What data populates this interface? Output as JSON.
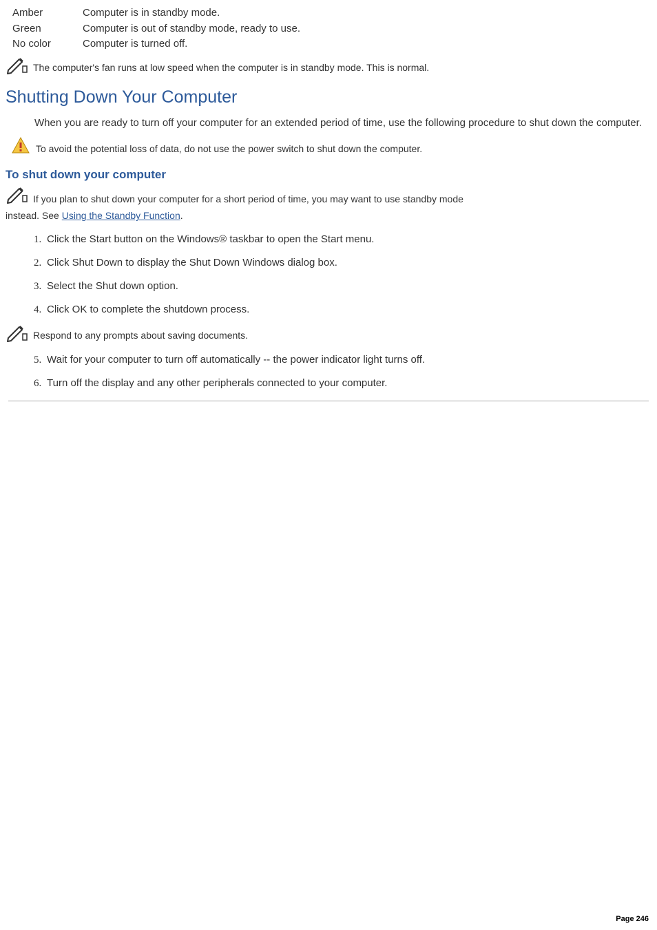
{
  "status": [
    {
      "label": "Amber",
      "desc": "Computer is in standby mode."
    },
    {
      "label": "Green",
      "desc": "Computer is out of standby mode, ready to use."
    },
    {
      "label": "No color",
      "desc": "Computer is turned off."
    }
  ],
  "note_fan": "The computer's fan runs at low speed when the computer is in standby mode. This is normal.",
  "h1": "Shutting Down Your Computer",
  "intro": "When you are ready to turn off your computer for an extended period of time, use the following procedure to shut down the computer.",
  "warning": "To avoid the potential loss of data, do not use the power switch to shut down the computer.",
  "h2": "To shut down your computer",
  "tip_pre": "If you plan to shut down your computer for a short period of time, you may want to use standby mode",
  "tip_instead": "instead. See ",
  "tip_link": "Using the Standby Function",
  "tip_after": ".",
  "steps_a": [
    "Click the Start button on the Windows® taskbar to open the Start menu.",
    "Click Shut Down to display the Shut Down Windows dialog box.",
    "Select the Shut down option.",
    "Click OK to complete the shutdown process."
  ],
  "note_respond": "Respond to any prompts about saving documents.",
  "steps_b": [
    "Wait for your computer to turn off automatically -- the power indicator light turns off.",
    "Turn off the display and any other peripherals connected to your computer."
  ],
  "page": "Page 246"
}
